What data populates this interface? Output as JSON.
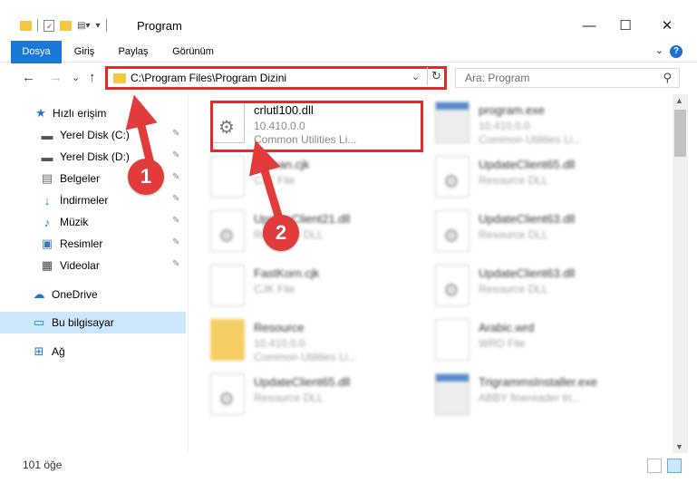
{
  "window": {
    "title": "Program",
    "minimize_glyph": "—",
    "maximize_glyph": "☐",
    "close_glyph": "✕"
  },
  "ribbon": {
    "tabs": [
      "Dosya",
      "Giriş",
      "Paylaş",
      "Görünüm"
    ],
    "help_glyph": "?",
    "expand_glyph": "⌄"
  },
  "address": {
    "path": "C:\\Program Files\\Program Dizini",
    "dropdown_glyph": "⌄",
    "refresh_glyph": "↻"
  },
  "nav_buttons": {
    "back": "←",
    "forward": "→",
    "recent": "⌄",
    "up": "↑"
  },
  "search": {
    "placeholder": "Ara: Program",
    "icon_glyph": "⚲"
  },
  "sidebar": {
    "items": [
      {
        "label": "Hızlı erişim",
        "icon": "star-icon",
        "glyph": "★",
        "color": "#1a74d2"
      },
      {
        "label": "Yerel Disk (C:)",
        "icon": "drive-icon",
        "glyph": "▬",
        "color": "#555555"
      },
      {
        "label": "Yerel Disk (D:)",
        "icon": "drive-icon",
        "glyph": "▬",
        "color": "#555555"
      },
      {
        "label": "Belgeler",
        "icon": "documents-icon",
        "glyph": "▤",
        "color": "#6a6a6a"
      },
      {
        "label": "İndirmeler",
        "icon": "downloads-icon",
        "glyph": "↓",
        "color": "#1a74d2"
      },
      {
        "label": "Müzik",
        "icon": "music-icon",
        "glyph": "♪",
        "color": "#1a74d2"
      },
      {
        "label": "Resimler",
        "icon": "pictures-icon",
        "glyph": "▣",
        "color": "#3a78b8"
      },
      {
        "label": "Videolar",
        "icon": "videos-icon",
        "glyph": "▦",
        "color": "#444444"
      },
      {
        "label": "OneDrive",
        "icon": "onedrive-icon",
        "glyph": "☁",
        "color": "#1a74d2"
      },
      {
        "label": "Bu bilgisayar",
        "icon": "computer-icon",
        "glyph": "▭",
        "color": "#1a74d2"
      },
      {
        "label": "Ağ",
        "icon": "network-icon",
        "glyph": "⊞",
        "color": "#1a74d2"
      }
    ],
    "pin_glyph": "📌"
  },
  "files": [
    {
      "name": "crlutl100.dll",
      "line1": "10.410.0.0",
      "line2": "Common Utilities Li...",
      "kind": "doc"
    },
    {
      "name": "program.exe",
      "line1": "10.410.0.0",
      "line2": "Common Utilities Li...",
      "kind": "exe"
    },
    {
      "name": "Korean.cjk",
      "line1": "CJK File",
      "line2": "",
      "kind": "doc"
    },
    {
      "name": "UpdateClient65.dll",
      "line1": "Resource DLL",
      "line2": "",
      "kind": "doc"
    },
    {
      "name": "UpdateClient21.dll",
      "line1": "Resource DLL",
      "line2": "",
      "kind": "doc"
    },
    {
      "name": "UpdateClient63.dll",
      "line1": "Resource DLL",
      "line2": "",
      "kind": "doc"
    },
    {
      "name": "FastKorn.cjk",
      "line1": "CJK File",
      "line2": "",
      "kind": "doc"
    },
    {
      "name": "UpdateClient63.dll",
      "line1": "Resource DLL",
      "line2": "",
      "kind": "doc"
    },
    {
      "name": "Resource",
      "line1": "10.410.0.0",
      "line2": "Common Utilities Li...",
      "kind": "folder"
    },
    {
      "name": "Arabic.wrd",
      "line1": "WRD File",
      "line2": "",
      "kind": "doc"
    },
    {
      "name": "UpdateClient65.dll",
      "line1": "Resource DLL",
      "line2": "",
      "kind": "doc"
    },
    {
      "name": "TrigrammsInstaller.exe",
      "line1": "ABBY finereader tri...",
      "line2": "",
      "kind": "exe"
    }
  ],
  "status": {
    "count": "101 öğe"
  },
  "callouts": [
    "1",
    "2"
  ],
  "colors": {
    "highlight": "#e02b2b",
    "accent": "#1a78d6",
    "selected": "#cce8ff"
  }
}
